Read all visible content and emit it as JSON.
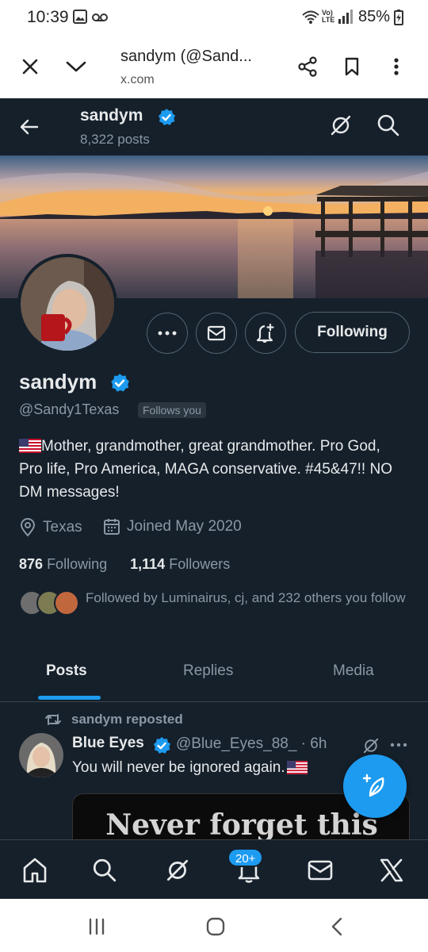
{
  "status_bar": {
    "time": "10:39",
    "battery": "85%",
    "icons": [
      "gallery-icon",
      "voicemail-icon",
      "wifi-icon",
      "volte-icon",
      "signal-icon",
      "battery-charging-icon"
    ]
  },
  "browser": {
    "title": "sandym (@Sand...",
    "domain": "x.com",
    "icons": [
      "close-icon",
      "chevron-down-icon",
      "share-icon",
      "bookmark-icon",
      "more-vertical-icon"
    ]
  },
  "profile_header": {
    "name": "sandym",
    "posts_count": "8,322 posts"
  },
  "profile": {
    "name": "sandym",
    "handle": "@Sandy1Texas",
    "follows_you": "Follows you",
    "bio": "Mother, grandmother, great grandmother. Pro God, Pro life, Pro America, MAGA conservative. #45&47!! NO DM messages!",
    "location": "Texas",
    "joined": "Joined May 2020",
    "following_count": "876",
    "following_label": "Following",
    "followers_count": "1,114",
    "followers_label": "Followers",
    "followed_by": "Followed by Luminairus, cj, and 232 others you follow",
    "follow_button": "Following"
  },
  "tabs": [
    {
      "label": "Posts",
      "active": true
    },
    {
      "label": "Replies",
      "active": false
    },
    {
      "label": "Media",
      "active": false
    }
  ],
  "tweet": {
    "repost_label": "sandym reposted",
    "author_name": "Blue Eyes",
    "author_handle": "@Blue_Eyes_88_ · 6h",
    "text": "You will never be ignored again.",
    "media_text": "Never forget this"
  },
  "bottom_nav": {
    "notifications_badge": "20+"
  },
  "colors": {
    "background": "#15202b",
    "accent": "#1d9bf0",
    "text_primary": "#e7e9ea",
    "text_secondary": "#8b98a5"
  }
}
